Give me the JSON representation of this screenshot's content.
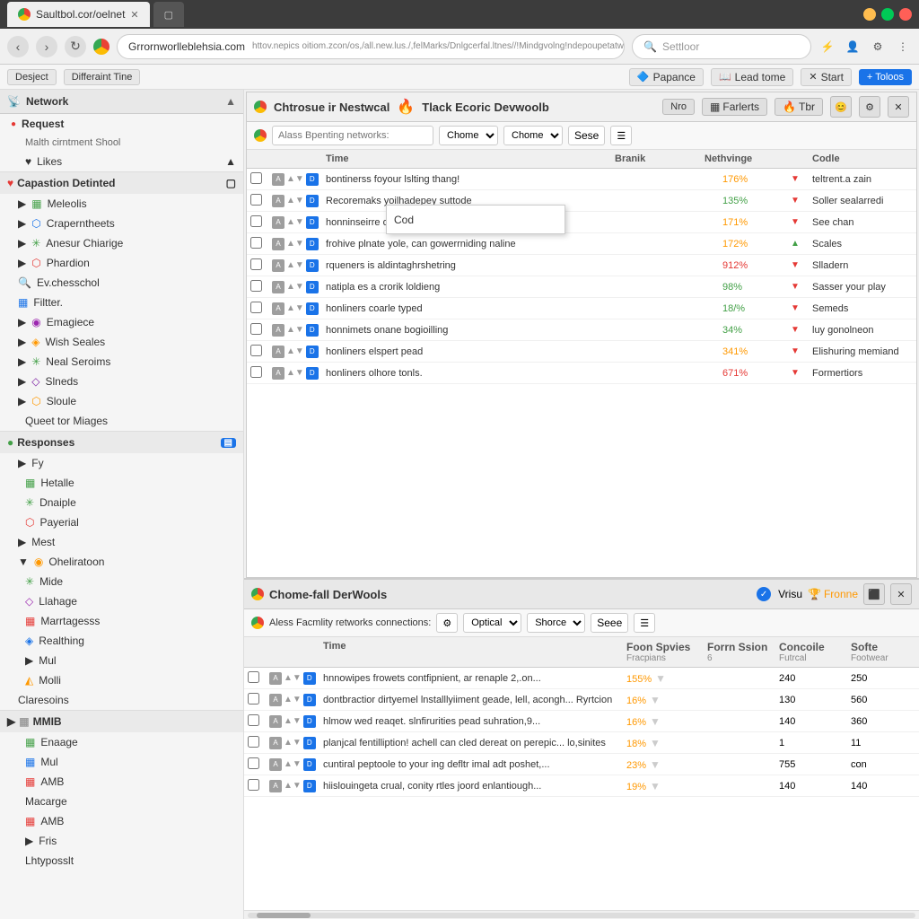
{
  "browser": {
    "tab_active": "Saultbol.cor/oelnet",
    "tab_inactive": "",
    "url": "httov.nepics oitiom.zcon/os,/all.new.lus./,felMarks/Dnlgcerfal.ltnes//!Mindgvolng!ndepoupetatwest...t...",
    "search_placeholder": "Settloor",
    "logo": "Grrornworlleblehsia.com"
  },
  "bookmarks": {
    "desject": "Desject",
    "differaint_tine": "Differaint Tine",
    "papance": "Papance",
    "lead_tome": "Lead tome",
    "start": "Start",
    "toloos": "+ Toloos"
  },
  "sidebar": {
    "section_title": "Network",
    "request_label": "Request",
    "request_sub": "Malth cirntment Shool",
    "likes": "Likes",
    "capastion_section": "Capastion Detinted",
    "items": [
      "Meleolis",
      "Craperntheets",
      "Anesur Chiarige",
      "Phardion",
      "Ev.chesschol",
      "Filtter.",
      "Emagiece",
      "Wish Seales",
      "Neal Seroims",
      "Slneds",
      "Sloule",
      "Queet tor Miages"
    ],
    "responses_label": "Responses",
    "responses_items": [
      "Fy",
      "Hetalle",
      "Dnaiple",
      "Payerial",
      "Mest",
      "Oheliratoon",
      "Mide",
      "Llahage",
      "Marrtagesss",
      "Realthing",
      "Mul",
      "Molli",
      "Claresoins",
      "MMIB",
      "Enaage",
      "Mul",
      "AMB",
      "Macarge",
      "AMB",
      "Fris",
      "Lhtyposslt"
    ]
  },
  "devtools_top": {
    "title": "Chtrosue ir Nestwcal",
    "tab_name": "Tlack Ecoric Devwoolb",
    "btn_nro": "Nro",
    "btn_farlerts": "Farlerts",
    "btn_tbr": "Tbr",
    "filter_placeholder": "Alass Bpenting networks:",
    "filter_option": "Chome",
    "filter_btn": "Sese",
    "columns": {
      "time": "Time",
      "brand": "Branik",
      "nethvinge": "Nethvinge",
      "codle": "Codle"
    },
    "rows": [
      {
        "name": "bontinerss foyour lslting thang!",
        "status": "176%",
        "arrow": "▼",
        "type": "teltrent.a zain"
      },
      {
        "name": "Recoremaks yoilhadepey suttode",
        "status": "135%",
        "arrow": "▼",
        "type": "Soller sealarredi"
      },
      {
        "name": "honninseirre of cone neyees, ses alt iimmuchs",
        "status": "171%",
        "arrow": "▼",
        "type": "See chan"
      },
      {
        "name": "frohive plnate yole, can gowerrniding naline",
        "status": "172%",
        "arrow": "▲",
        "type": "Scales"
      },
      {
        "name": "rqueners is aldintaghrshetring",
        "status": "912%",
        "arrow": "▼",
        "type": "Slladern"
      },
      {
        "name": "natipla es a crorik loldieng",
        "status": "98%",
        "arrow": "▼",
        "type": "Sasser your play"
      },
      {
        "name": "honliners coarle typed",
        "status": "18/%",
        "arrow": "▼",
        "type": "Semeds"
      },
      {
        "name": "honnimets onane bogioilling",
        "status": "34%",
        "arrow": "▼",
        "type": "luy gonolneon"
      },
      {
        "name": "honliners elspert pead",
        "status": "341%",
        "arrow": "▼",
        "type": "Elishuring memiand"
      },
      {
        "name": "honliners olhore tonls.",
        "status": "671%",
        "arrow": "▼",
        "type": "Formertiors"
      }
    ],
    "dropdown_text": "Cod"
  },
  "devtools_bottom": {
    "title": "Chome-fall DerWools",
    "check_label": "Vrisu",
    "fronne_label": "Fronne",
    "filter_placeholder": "Aless Facmlity retworks connections:",
    "filter_option_1": "Optical",
    "filter_option_2": "Shorce",
    "filter_btn": "Seee",
    "columns": {
      "time": "Time",
      "foon_spvies": "Foon Spvies",
      "form_ssion": "Forrn Ssion",
      "console": "Concoile",
      "soft": "Softe",
      "sub1": "Fracpians",
      "sub2": "6",
      "sub3": "Futrcal",
      "sub4": "Footwear"
    },
    "rows": [
      {
        "time": "",
        "name": "hnnowipes frowets contfipnient, ar renaple 2,.on...",
        "fsize": "155%",
        "fsize2": "",
        "console": "240",
        "soft": "250"
      },
      {
        "time": "",
        "name": "dontbractior dirtyemel lnstalllyiiment geade, lell, acongh... Ryrtcion",
        "fsize": "16%",
        "fsize2": "",
        "console": "130",
        "soft": "560"
      },
      {
        "time": "",
        "name": "hlmow wed reaqet. slnfirurities pead suhration,9...",
        "fsize": "16%",
        "fsize2": "",
        "console": "140",
        "soft": "360"
      },
      {
        "time": "",
        "name": "planjcal fentilliption! achell can cled dereat on perepic... lo,sinites",
        "fsize": "18%",
        "fsize2": "",
        "console": "1",
        "soft": "11"
      },
      {
        "time": "",
        "name": "cuntiral peptoole to your ing defltr imal adt poshet,...",
        "fsize": "23%",
        "fsize2": "",
        "console": "755",
        "soft": "con"
      },
      {
        "time": "",
        "name": "hiislouingeta crual, conity rtles joord enlantiough...",
        "fsize": "19%",
        "fsize2": "",
        "console": "140",
        "soft": "140"
      }
    ]
  }
}
